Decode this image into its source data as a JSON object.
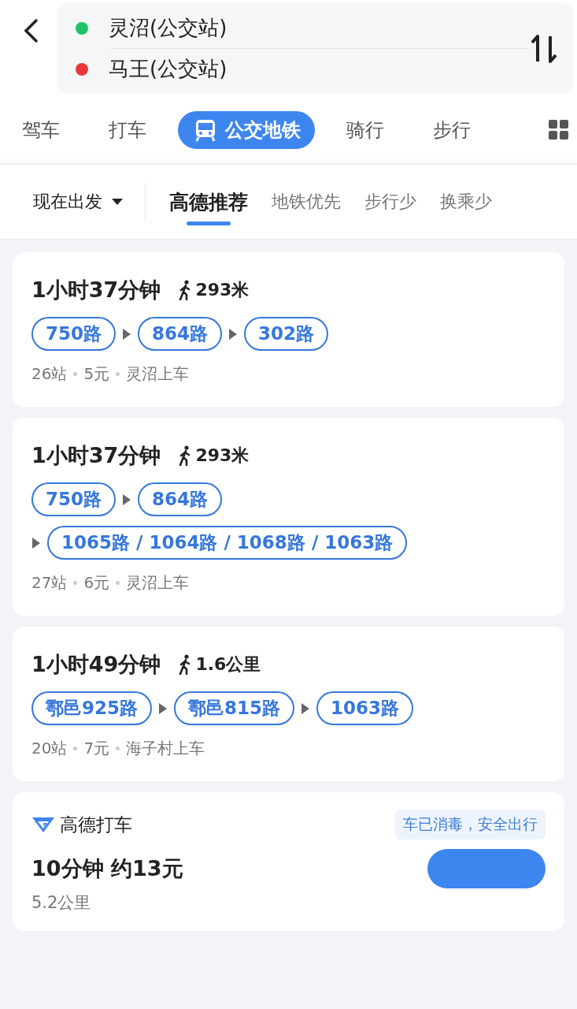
{
  "origin": "灵沼(公交站)",
  "destination": "马王(公交站)",
  "modes": [
    {
      "label": "驾车",
      "selected": false
    },
    {
      "label": "打车",
      "selected": false
    },
    {
      "label": "公交地铁",
      "selected": true
    },
    {
      "label": "骑行",
      "selected": false
    },
    {
      "label": "步行",
      "selected": false
    }
  ],
  "depart": "现在出发",
  "sorts": [
    {
      "label": "高德推荐",
      "selected": true
    },
    {
      "label": "地铁优先",
      "selected": false
    },
    {
      "label": "步行少",
      "selected": false
    },
    {
      "label": "换乘少",
      "selected": false
    }
  ],
  "routes": [
    {
      "duration": "1小时37分钟",
      "walk": "293米",
      "lines": [
        "750路",
        "864路",
        "302路"
      ],
      "stops": "26站",
      "fare": "5元",
      "board": "灵沼上车"
    },
    {
      "duration": "1小时37分钟",
      "walk": "293米",
      "lines": [
        "750路",
        "864路",
        "1065路 / 1064路 / 1068路 / 1063路"
      ],
      "stops": "27站",
      "fare": "6元",
      "board": "灵沼上车"
    },
    {
      "duration": "1小时49分钟",
      "walk": "1.6公里",
      "lines": [
        "鄠邑925路",
        "鄠邑815路",
        "1063路"
      ],
      "stops": "20站",
      "fare": "7元",
      "board": "海子村上车"
    }
  ],
  "taxi": {
    "brand": "高德打车",
    "badge": "车已消毒，安全出行",
    "eta_price": "10分钟 约13元",
    "distance": "5.2公里"
  }
}
